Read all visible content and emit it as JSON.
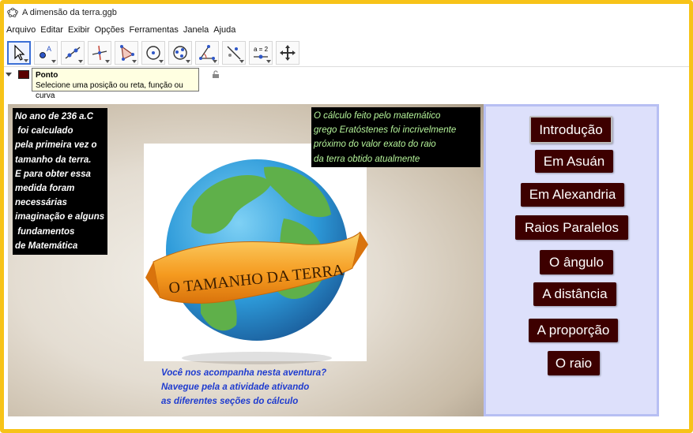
{
  "window": {
    "title": "A dimensão da terra.ggb"
  },
  "menu": [
    "Arquivo",
    "Editar",
    "Exibir",
    "Opções",
    "Ferramentas",
    "Janela",
    "Ajuda"
  ],
  "toolbar": {
    "tools": [
      {
        "name": "move-tool-icon",
        "selected": true
      },
      {
        "name": "point-tool-icon",
        "selected": false,
        "label": "A"
      },
      {
        "name": "line-tool-icon",
        "selected": false
      },
      {
        "name": "perpendicular-line-tool-icon",
        "selected": false
      },
      {
        "name": "polygon-tool-icon",
        "selected": false
      },
      {
        "name": "circle-tool-icon",
        "selected": false
      },
      {
        "name": "conic-tool-icon",
        "selected": false
      },
      {
        "name": "angle-tool-icon",
        "selected": false
      },
      {
        "name": "reflect-tool-icon",
        "selected": false
      },
      {
        "name": "slider-tool-icon",
        "selected": false,
        "label": "a = 2"
      },
      {
        "name": "move-graphics-view-icon",
        "selected": false
      }
    ]
  },
  "stylebar": {
    "color": "#5a0000"
  },
  "tooltip": {
    "title": "Ponto",
    "text": "Selecione uma posição ou reta, função ou curva"
  },
  "graphics": {
    "intro_lines": [
      "No ano de 236 a.C",
      " foi calculado",
      "pela primeira vez o",
      "tamanho da terra.",
      "E para obter essa",
      "medida foram",
      "necessárias",
      "imaginação e alguns",
      " fundamentos",
      "de Matemática"
    ],
    "calc_lines": [
      "O cálculo feito pelo matemático",
      "grego Eratóstenes foi incrivelmente",
      "próximo do valor exato do raio",
      "da terra obtido atualmente"
    ],
    "invite_lines": [
      "Você nos acompanha nesta aventura?",
      "Navegue pela a atividade ativando",
      "as diferentes seções do cálculo"
    ],
    "banner_text": "O TAMANHO DA TERRA"
  },
  "panel": {
    "buttons": [
      {
        "label": "Introdução",
        "active": true
      },
      {
        "label": "Em Asuán",
        "active": false
      },
      {
        "label": "Em Alexandria",
        "active": false
      },
      {
        "label": "Raios Paralelos",
        "active": false
      },
      {
        "label": "O ângulo",
        "active": false
      },
      {
        "label": "A distância",
        "active": false
      },
      {
        "label": "A proporção",
        "active": false
      },
      {
        "label": "O raio",
        "active": false
      }
    ]
  },
  "colors": {
    "frame": "#f7c318",
    "button_bg": "#3d0000",
    "panel_bg": "#dde0fb",
    "calc_text": "#b6f59b",
    "invite_text": "#1f3ccf"
  }
}
